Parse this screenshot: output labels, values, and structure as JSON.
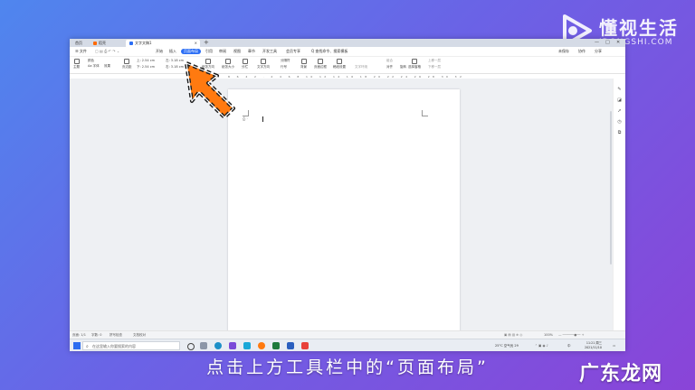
{
  "brand": {
    "name": "懂视生活",
    "domain": "IDONGSHI.COM"
  },
  "titlebar": {
    "tabs": [
      {
        "label": "首页",
        "color": "#2b6ef5"
      },
      {
        "label": "稻壳",
        "color": "#ff6a00"
      },
      {
        "label": "文字文稿1",
        "color": "#2b6ef5"
      }
    ],
    "new_tab": "+",
    "close": "×"
  },
  "menubar": {
    "file": "☰ 文件",
    "items": [
      "开始",
      "插入",
      "页面布局",
      "引用",
      "审阅",
      "视图",
      "章节",
      "开发工具",
      "会员专享"
    ],
    "active_index": 2,
    "search": "Q 查找命令、搜索模板",
    "right": [
      "未保存",
      "协作",
      "分享"
    ]
  },
  "ribbon": {
    "buttons": [
      "主题",
      "Aa 字体",
      "效果",
      "页边距",
      "纸张方向",
      "纸张大小",
      "分栏",
      "文字方向",
      "行号",
      "背景",
      "页面边框",
      "稿纸设置",
      "文字环绕",
      "对齐",
      "旋转",
      "选择窗格"
    ],
    "margins": [
      "上: 2.54 cm",
      "下: 2.54 cm",
      "左: 3.18 cm",
      "右: 3.18 cm"
    ],
    "colors": "颜色",
    "breaks": "分隔符",
    "move": [
      "上移一层",
      "下移一层"
    ],
    "group": "组合"
  },
  "ruler": "8 6 4 2 · 2 4 6 8 10 12 14 16 18 20 22 24 26 28 30 32 34 36 38",
  "statusbar": {
    "left": [
      "页面: 1/1",
      "字数: 0",
      "拼写检查",
      "文档校对"
    ],
    "zoom": "100%"
  },
  "taskbar": {
    "search_placeholder": "在这里输入你要搜索的内容",
    "weather": "25°C 空气优 29",
    "lang": "中",
    "time": "11:21 周三",
    "date": "2021/11/10"
  },
  "caption": "点击上方工具栏中的“页面布局”",
  "watermark": "广东龙网",
  "colors": {
    "accent": "#2b6ef5",
    "arrow": "#ff7a10"
  }
}
